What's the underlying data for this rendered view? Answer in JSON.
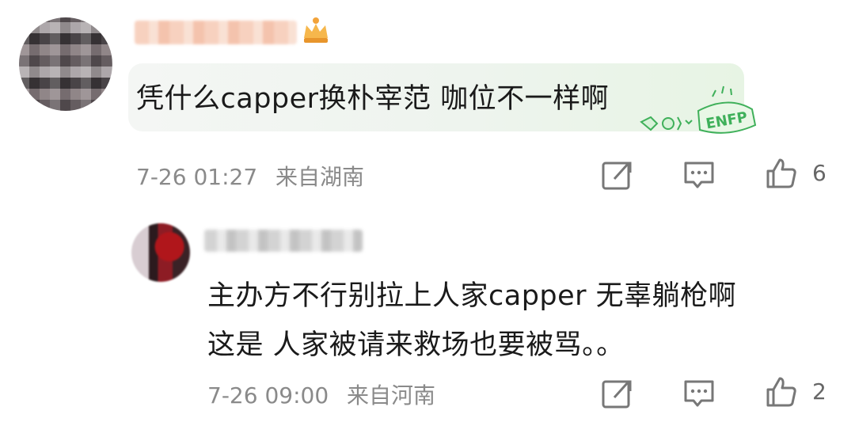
{
  "top_comment": {
    "text": "凭什么capper换朴宰范 咖位不一样啊",
    "badge_text": "ENFP",
    "time": "7-26 01:27",
    "location": "来自湖南",
    "like_count": "6"
  },
  "reply": {
    "text_line1": "主办方不行别拉上人家capper 无辜躺枪啊",
    "text_line2": "这是 人家被请来救场也要被骂。。",
    "time": "7-26 09:00",
    "location": "来自河南",
    "like_count": "2"
  },
  "colors": {
    "meta_gray": "#8a8a8a",
    "bubble_green": "#e7f4e4",
    "badge_green": "#3fb05a"
  },
  "icons": [
    "share-icon",
    "comment-icon",
    "like-icon",
    "crown-icon"
  ]
}
